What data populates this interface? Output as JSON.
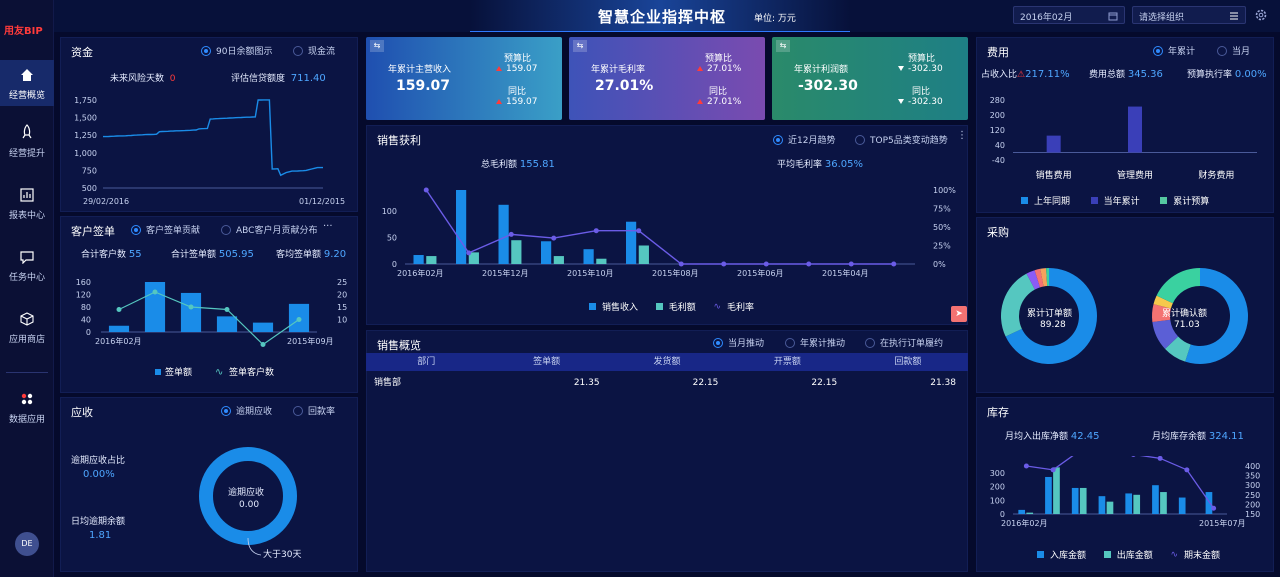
{
  "app": {
    "logo": "用友BIP",
    "title": "智慧企业指挥中枢",
    "unit": "单位: 万元",
    "date": "2016年02月",
    "org_placeholder": "请选择组织",
    "avatar": "DE"
  },
  "nav": [
    {
      "label": "经营概览",
      "icon": "home-icon",
      "active": true
    },
    {
      "label": "经营提升",
      "icon": "rocket-icon"
    },
    {
      "label": "报表中心",
      "icon": "report-icon"
    },
    {
      "label": "任务中心",
      "icon": "chat-icon"
    },
    {
      "label": "应用商店",
      "icon": "cube-icon"
    },
    {
      "label": "数据应用",
      "icon": "apps-icon"
    }
  ],
  "funds": {
    "title": "资金",
    "radio1": "90日余额图示",
    "radio2": "现金流",
    "risk_label": "未来风险天数",
    "risk_value": "0",
    "credit_label": "评估信贷额度",
    "credit_value": "711.40"
  },
  "orders": {
    "title": "客户签单",
    "radio1": "客户签单贡献",
    "radio2": "ABC客户月贡献分布",
    "cust_label": "合计客户数",
    "cust_value": "55",
    "amount_label": "合计签单额",
    "amount_value": "505.95",
    "avg_label": "客均签单额",
    "avg_value": "9.20"
  },
  "recv": {
    "title": "应收",
    "radio1": "逾期应收",
    "radio2": "回款率",
    "ratio_label": "逾期应收占比",
    "ratio_value": "0.00%",
    "daily_label": "日均逾期余额",
    "daily_value": "1.81",
    "donut_label": "逾期应收",
    "donut_value": "0.00",
    "callout": "大于30天"
  },
  "kpis": [
    {
      "title": "年累计主营收入",
      "value": "159.07",
      "b1_label": "预算比",
      "b1_value": "159.07",
      "b2_label": "同比",
      "b2_value": "159.07",
      "color_a": "#1f4fb0",
      "color_b": "#3a9fc7"
    },
    {
      "title": "年累计毛利率",
      "value": "27.01%",
      "b1_label": "预算比",
      "b1_value": "27.01%",
      "b2_label": "同比",
      "b2_value": "27.01%",
      "color_a": "#3e53b8",
      "color_b": "#7a4bb0"
    },
    {
      "title": "年累计利润额",
      "value": "-302.30",
      "b1_label": "预算比",
      "b1_value": "-302.30",
      "b2_label": "同比",
      "b2_value": "-302.30",
      "color_a": "#2a8a6a",
      "color_b": "#1e7f85"
    }
  ],
  "sales": {
    "title": "销售获利",
    "radio1": "近12月趋势",
    "radio2": "TOP5品类变动趋势",
    "gp_label": "总毛利额",
    "gp_value": "155.81",
    "avg_label": "平均毛利率",
    "avg_value": "36.05%",
    "legend": [
      "销售收入",
      "毛利额",
      "毛利率"
    ]
  },
  "overview": {
    "title": "销售概览",
    "radio1": "当月推动",
    "radio2": "年累计推动",
    "radio3": "在执行订单履约",
    "columns": [
      "部门",
      "签单额",
      "发货额",
      "开票额",
      "回款额"
    ],
    "rows": [
      [
        "销售部",
        "21.35",
        "22.15",
        "22.15",
        "21.38"
      ]
    ]
  },
  "cost": {
    "title": "费用",
    "radio1": "年累计",
    "radio2": "当月",
    "occ_label": "占收入比",
    "occ_value": "217.11%",
    "total_label": "费用总额",
    "total_value": "345.36",
    "exec_label": "预算执行率",
    "exec_value": "0.00%",
    "legend": [
      "上年同期",
      "当年累计",
      "累计预算"
    ]
  },
  "purchase": {
    "title": "采购",
    "d1_label": "累计订单额",
    "d1_value": "89.28",
    "d2_label": "累计确认额",
    "d2_value": "71.03"
  },
  "stock": {
    "title": "库存",
    "in_label": "月均入出库净额",
    "in_value": "42.45",
    "out_label": "月均库存余额",
    "out_value": "324.11",
    "legend": [
      "入库金额",
      "出库金额",
      "期末金额"
    ]
  },
  "chart_data": [
    {
      "type": "line",
      "name": "funds",
      "x_start": "29/02/2016",
      "x_end": "01/12/2015",
      "ylim": [
        500,
        1750
      ],
      "yticks": [
        "1,750",
        "1,500",
        "1,250",
        "1,000",
        "750",
        "500"
      ],
      "values": [
        1230,
        1230,
        1232,
        1234,
        1236,
        1238,
        1240,
        1240,
        1242,
        1244,
        1246,
        1250,
        1252,
        1254,
        1256,
        1258,
        1260,
        1260,
        1262,
        1264,
        1300,
        1302,
        1304,
        1306,
        1308,
        1310,
        1312,
        1312,
        1314,
        1316,
        1318,
        1320,
        1322,
        1324,
        1340,
        1342,
        1344,
        1346,
        1480,
        1482,
        1484,
        1486,
        1488,
        1490,
        1492,
        1494,
        1496,
        1498,
        1500,
        1502,
        1504,
        1506,
        1506,
        1508,
        1510,
        1750,
        1750,
        1752,
        1752,
        1752,
        770,
        772,
        774,
        680,
        700,
        720,
        730,
        740,
        740,
        742,
        744,
        746,
        750,
        760,
        770,
        780,
        790,
        790,
        790
      ]
    },
    {
      "type": "bar",
      "name": "orders",
      "categories": [
        "2016年02月",
        "",
        "",
        "",
        "",
        "2015年09月"
      ],
      "values": [
        20,
        160,
        125,
        50,
        30,
        90
      ],
      "line": [
        14,
        21,
        15,
        14,
        0,
        10
      ],
      "yticks_left": [
        "160",
        "120",
        "80",
        "40",
        "0"
      ],
      "yticks_right": [
        "25",
        "20",
        "15",
        "10"
      ],
      "legend": [
        "签单额",
        "签单客户数"
      ]
    },
    {
      "type": "bar",
      "name": "sales",
      "categories": [
        "2016年02月",
        "",
        "2015年12月",
        "",
        "2015年10月",
        "",
        "2015年08月",
        "",
        "2015年06月",
        "",
        "2015年04月",
        ""
      ],
      "revenue": [
        17,
        140,
        112,
        43,
        28,
        80,
        0,
        0,
        0,
        0,
        0,
        0
      ],
      "profit": [
        15,
        22,
        45,
        15,
        10,
        35,
        0,
        0,
        0,
        0,
        0,
        0
      ],
      "margin": [
        100,
        15,
        40,
        35,
        45,
        45,
        0,
        0,
        0,
        0,
        0,
        0
      ],
      "yticks_left": [
        "100",
        "50",
        "0"
      ],
      "yticks_right": [
        "100%",
        "75%",
        "50%",
        "25%",
        "0%"
      ]
    },
    {
      "type": "bar",
      "name": "cost",
      "categories": [
        "销售费用",
        "管理费用",
        "财务费用"
      ],
      "series": [
        {
          "name": "上年同期",
          "values": [
            0,
            0,
            0
          ]
        },
        {
          "name": "当年累计",
          "values": [
            90,
            245,
            0
          ]
        },
        {
          "name": "累计预算",
          "values": [
            0,
            0,
            0
          ]
        }
      ],
      "yticks": [
        "280",
        "200",
        "120",
        "40",
        "-40"
      ]
    },
    {
      "type": "pie",
      "name": "purchase-order",
      "values": [
        70,
        25,
        3,
        2,
        2,
        1
      ],
      "colors": [
        "#1a8ce8",
        "#55c7c0",
        "#8b5cf6",
        "#f47272",
        "#f5a25c",
        "#3ad1a0"
      ]
    },
    {
      "type": "pie",
      "name": "purchase-confirm",
      "values": [
        55,
        8,
        10,
        6,
        3,
        18
      ],
      "colors": [
        "#1a8ce8",
        "#55c7c0",
        "#5b5fd6",
        "#f47272",
        "#f5c84c",
        "#3ad1a0"
      ]
    },
    {
      "type": "bar",
      "name": "stock",
      "categories": [
        "2016年02月",
        "",
        "",
        "",
        "",
        "",
        "",
        "2015年07月"
      ],
      "in": [
        30,
        270,
        190,
        130,
        150,
        210,
        120,
        160
      ],
      "out": [
        10,
        340,
        190,
        90,
        140,
        160,
        0,
        0
      ],
      "end": [
        250,
        230,
        330,
        340,
        310,
        290,
        230,
        30
      ],
      "yticks_left": [
        "300",
        "200",
        "100",
        "0"
      ],
      "yticks_right": [
        "400",
        "350",
        "300",
        "250",
        "200",
        "150"
      ],
      "legend": [
        "入库金额",
        "出库金额",
        "期末金额"
      ]
    }
  ]
}
